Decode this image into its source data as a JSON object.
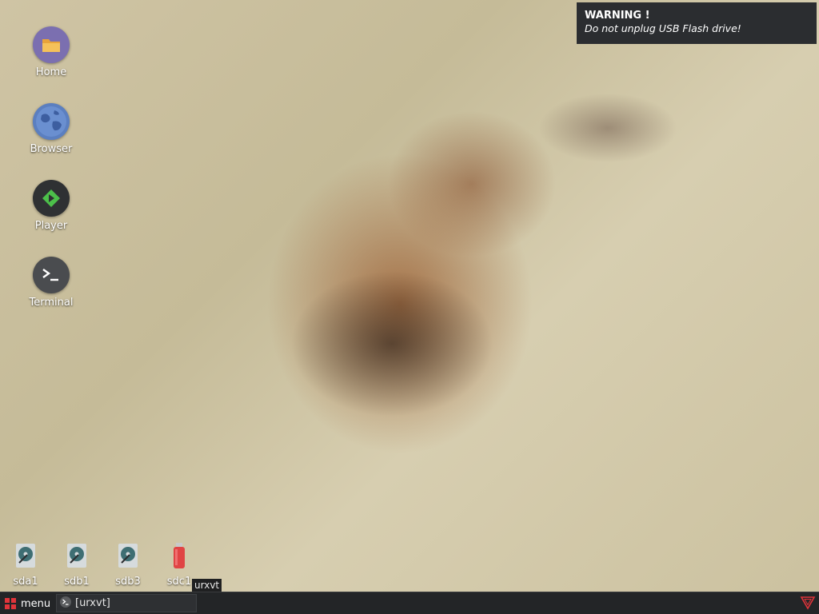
{
  "desktop": {
    "icons": [
      {
        "label": "Home",
        "icon": "folder-icon"
      },
      {
        "label": "Browser",
        "icon": "globe-icon"
      },
      {
        "label": "Player",
        "icon": "play-icon"
      },
      {
        "label": "Terminal",
        "icon": "terminal-icon"
      }
    ],
    "drives": [
      {
        "label": "sda1",
        "icon": "hard-drive-icon"
      },
      {
        "label": "sdb1",
        "icon": "hard-drive-icon"
      },
      {
        "label": "sdb3",
        "icon": "hard-drive-icon"
      },
      {
        "label": "sdc1",
        "icon": "usb-drive-icon"
      }
    ]
  },
  "notification": {
    "title": "WARNING !",
    "body": "Do not unplug USB Flash drive!"
  },
  "tooltip": {
    "text": "urxvt"
  },
  "taskbar": {
    "menu_label": "menu",
    "tasks": [
      {
        "label": "[urxvt]",
        "icon": "terminal-icon"
      }
    ],
    "tray_icon": "network-triangle-icon"
  },
  "colors": {
    "taskbar_bg": "#232527",
    "menu_accent": "#e0343a",
    "notification_bg": "#2b2d30",
    "player_accent": "#4cc04a"
  }
}
